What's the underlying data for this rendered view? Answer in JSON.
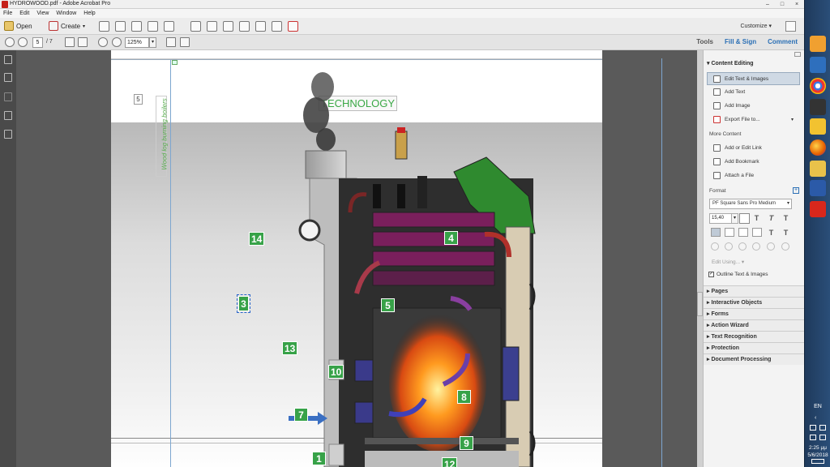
{
  "window": {
    "title": "HYDROWOOD.pdf - Adobe Acrobat Pro",
    "controls": [
      "–",
      "□",
      "×"
    ]
  },
  "menu": [
    "File",
    "Edit",
    "View",
    "Window",
    "Help"
  ],
  "toolbar": {
    "open_label": "Open",
    "create_label": "Create",
    "customize_label": "Customize"
  },
  "navigation": {
    "current_page": "5",
    "total_pages": "/ 7",
    "zoom": "125%"
  },
  "right_tabs": [
    "Tools",
    "Fill & Sign",
    "Comment"
  ],
  "document": {
    "page_label": "5",
    "title": "TECHNOLOGY",
    "vertical_caption": "Wood log burning boilers",
    "callouts": [
      "14",
      "4",
      "3",
      "5",
      "13",
      "10",
      "8",
      "7",
      "9",
      "1",
      "12"
    ]
  },
  "panel": {
    "content_editing_header": "Content Editing",
    "edit_text_images": "Edit Text & Images",
    "add_text": "Add Text",
    "add_image": "Add Image",
    "export_file": "Export File to...",
    "more_content": "More Content",
    "add_edit_link": "Add or Edit Link",
    "add_bookmark": "Add Bookmark",
    "attach_file": "Attach a File",
    "format_label": "Format",
    "font_name": "PF Square Sans Pro Medium",
    "font_size": "15,40",
    "edit_using": "Edit Using...",
    "outline_checkbox": "Outline Text & Images",
    "sections": [
      "Pages",
      "Interactive Objects",
      "Forms",
      "Action Wizard",
      "Text Recognition",
      "Protection",
      "Document Processing"
    ]
  },
  "taskbar": {
    "language": "EN",
    "time": "2:25 μμ",
    "date": "5/6/2018"
  },
  "colors": {
    "accent_green": "#37a248",
    "accent_blue": "#2a6fb5",
    "taskbar": "#1f3a5c"
  }
}
